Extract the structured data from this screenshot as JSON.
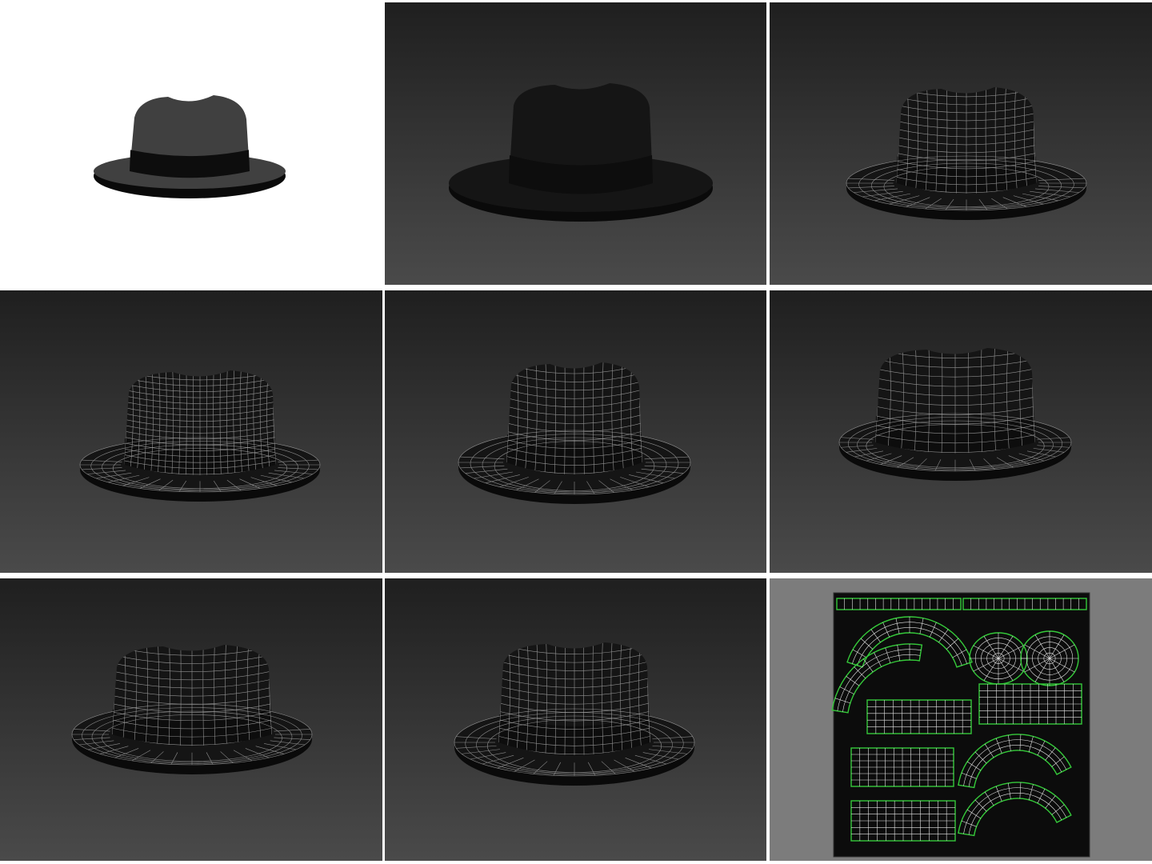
{
  "sheet": {
    "layout": "3x3 grid",
    "colors": {
      "render_bg_top": "#1f1f1f",
      "render_bg_bottom": "#4a4a4a",
      "hat": "#151515",
      "band": "#0d0d0d",
      "wire": "#bdbdbd",
      "uv_panel": "#7c7c7c",
      "uv_canvas": "#0c0c0c",
      "uv_edge": "#35c93a",
      "uv_wire": "#e6e6e6"
    },
    "panels": [
      {
        "id": "studio-render-white",
        "style": "shaded",
        "background": "white"
      },
      {
        "id": "render-shaded",
        "style": "shaded",
        "background": "gradient"
      },
      {
        "id": "render-wireframe-1",
        "style": "wireframe",
        "background": "gradient"
      },
      {
        "id": "render-wireframe-2",
        "style": "wireframe",
        "background": "gradient"
      },
      {
        "id": "render-wireframe-3",
        "style": "wireframe",
        "background": "gradient"
      },
      {
        "id": "render-wireframe-back",
        "style": "wireframe",
        "background": "gradient"
      },
      {
        "id": "render-wireframe-side",
        "style": "wireframe",
        "background": "gradient"
      },
      {
        "id": "render-wireframe-4",
        "style": "wireframe",
        "background": "gradient"
      },
      {
        "id": "uv-layout",
        "style": "uv",
        "background": "grey"
      }
    ]
  }
}
